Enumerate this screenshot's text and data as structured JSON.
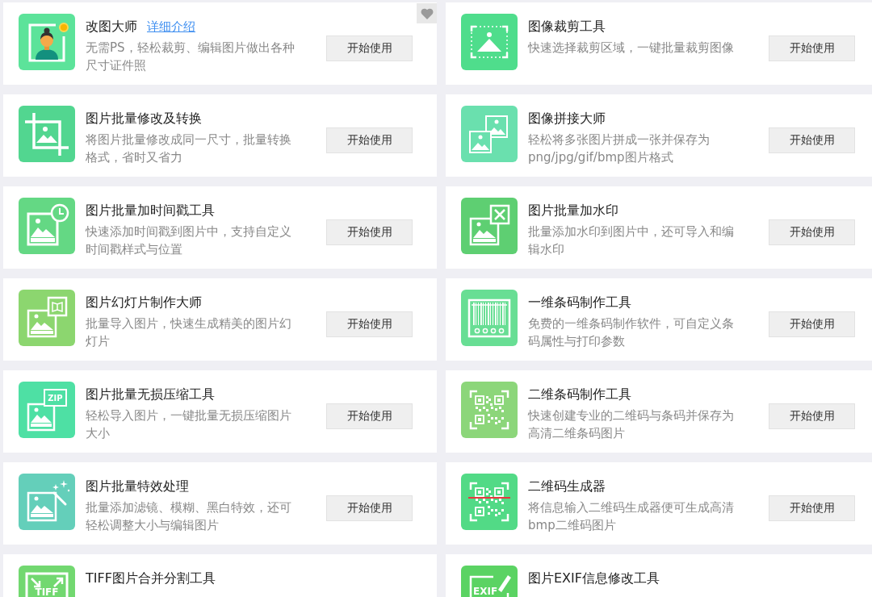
{
  "cards": [
    {
      "kind": "person-photo",
      "color": "#5ce39a",
      "title": "改图大师",
      "link": "详细介绍",
      "description": "无需PS，轻松裁剪、编辑图片做出各种尺寸证件照",
      "button": "开始使用",
      "favorite_button": true
    },
    {
      "kind": "crop-select",
      "color": "#4fdd8c",
      "title": "图像裁剪工具",
      "description": "快速选择裁剪区域，一键批量裁剪图像",
      "button": "开始使用"
    },
    {
      "kind": "crop",
      "color": "#52d690",
      "title": "图片批量修改及转换",
      "description": "将图片批量修改成同一尺寸，批量转换格式，省时又省力",
      "button": "开始使用"
    },
    {
      "kind": "collage",
      "color": "#6ae0ae",
      "title": "图像拼接大师",
      "description": "轻松将多张图片拼成一张并保存为png/jpg/gif/bmp图片格式",
      "button": "开始使用"
    },
    {
      "kind": "clock-photo",
      "color": "#64d884",
      "title": "图片批量加时间戳工具",
      "description": "快速添加时间戳到图片中，支持自定义时间戳样式与位置",
      "button": "开始使用"
    },
    {
      "kind": "watermark",
      "color": "#5ecf72",
      "title": "图片批量加水印",
      "description": "批量添加水印到图片中，还可导入和编辑水印",
      "button": "开始使用"
    },
    {
      "kind": "slideshow",
      "color": "#8cd66f",
      "title": "图片幻灯片制作大师",
      "description": "批量导入图片，快速生成精美的图片幻灯片",
      "button": "开始使用"
    },
    {
      "kind": "barcode",
      "color": "#68de94",
      "title": "一维条码制作工具",
      "description": "免费的一维条码制作软件，可自定义条码属性与打印参数",
      "button": "开始使用"
    },
    {
      "kind": "zip",
      "color": "#4ee0a4",
      "icon_text": "ZIP",
      "title": "图片批量无损压缩工具",
      "description": "轻松导入图片，一键批量无损压缩图片大小",
      "button": "开始使用"
    },
    {
      "kind": "qr-code",
      "color": "#8cd67a",
      "title": "二维条码制作工具",
      "description": "快速创建专业的二维码与条码并保存为高清二维条码图片",
      "button": "开始使用"
    },
    {
      "kind": "effects",
      "color": "#64cfba",
      "title": "图片批量特效处理",
      "description": "批量添加滤镜、模糊、黑白特效，还可轻松调整大小与编辑图片",
      "button": "开始使用"
    },
    {
      "kind": "qr-scan",
      "color": "#52da86",
      "title": "二维码生成器",
      "description": "将信息输入二维码生成器便可生成高清bmp二维码图片",
      "button": "开始使用"
    },
    {
      "kind": "tiff",
      "color": "#72d870",
      "icon_text": "TIFF",
      "title": "TIFF图片合并分割工具"
    },
    {
      "kind": "exif",
      "color": "#5bd363",
      "icon_text": "EXIF",
      "title": "图片EXIF信息修改工具"
    }
  ]
}
